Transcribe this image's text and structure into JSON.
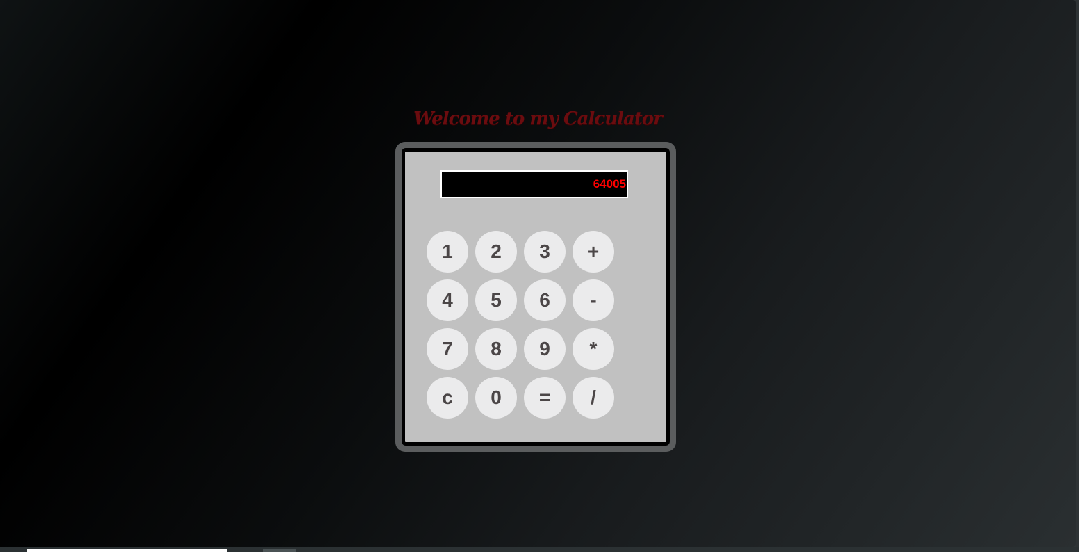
{
  "page": {
    "title": "Welcome to my Calculator"
  },
  "calculator": {
    "display_value": "64005",
    "keys": [
      {
        "label": "1",
        "name": "key-1"
      },
      {
        "label": "2",
        "name": "key-2"
      },
      {
        "label": "3",
        "name": "key-3"
      },
      {
        "label": "+",
        "name": "key-plus"
      },
      {
        "label": "4",
        "name": "key-4"
      },
      {
        "label": "5",
        "name": "key-5"
      },
      {
        "label": "6",
        "name": "key-6"
      },
      {
        "label": "-",
        "name": "key-minus"
      },
      {
        "label": "7",
        "name": "key-7"
      },
      {
        "label": "8",
        "name": "key-8"
      },
      {
        "label": "9",
        "name": "key-9"
      },
      {
        "label": "*",
        "name": "key-multiply"
      },
      {
        "label": "c",
        "name": "key-clear"
      },
      {
        "label": "0",
        "name": "key-0"
      },
      {
        "label": "=",
        "name": "key-equals"
      },
      {
        "label": "/",
        "name": "key-divide"
      }
    ]
  },
  "colors": {
    "title": "#6b0c0f",
    "display_text": "#ff0000",
    "display_background": "#000000",
    "calculator_body": "#c1c1c1",
    "calculator_frame": "#5b5d5e",
    "key_background": "#ebebec",
    "key_text": "#4b4647"
  }
}
